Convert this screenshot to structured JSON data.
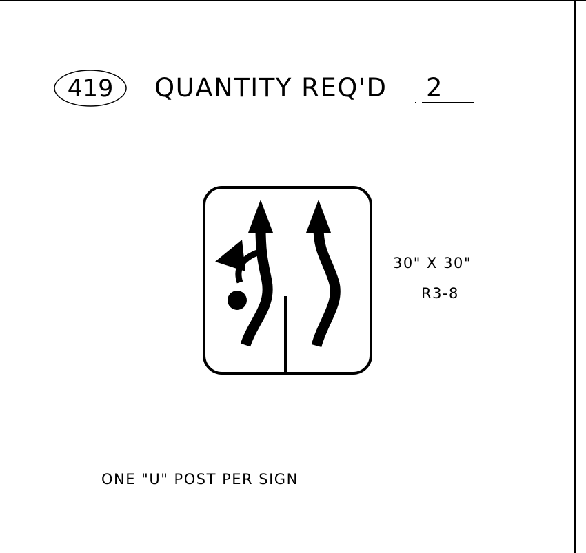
{
  "header": {
    "sign_number": "419",
    "quantity_label": "QUANTITY REQ'D",
    "quantity_value": "2"
  },
  "sign": {
    "size": "30\" X 30\"",
    "code": "R3-8",
    "icons": [
      "left-turn-arrow-icon",
      "right-curved-arrow-icon",
      "roundabout-dot-icon"
    ]
  },
  "note": "ONE \"U\" POST PER SIGN"
}
